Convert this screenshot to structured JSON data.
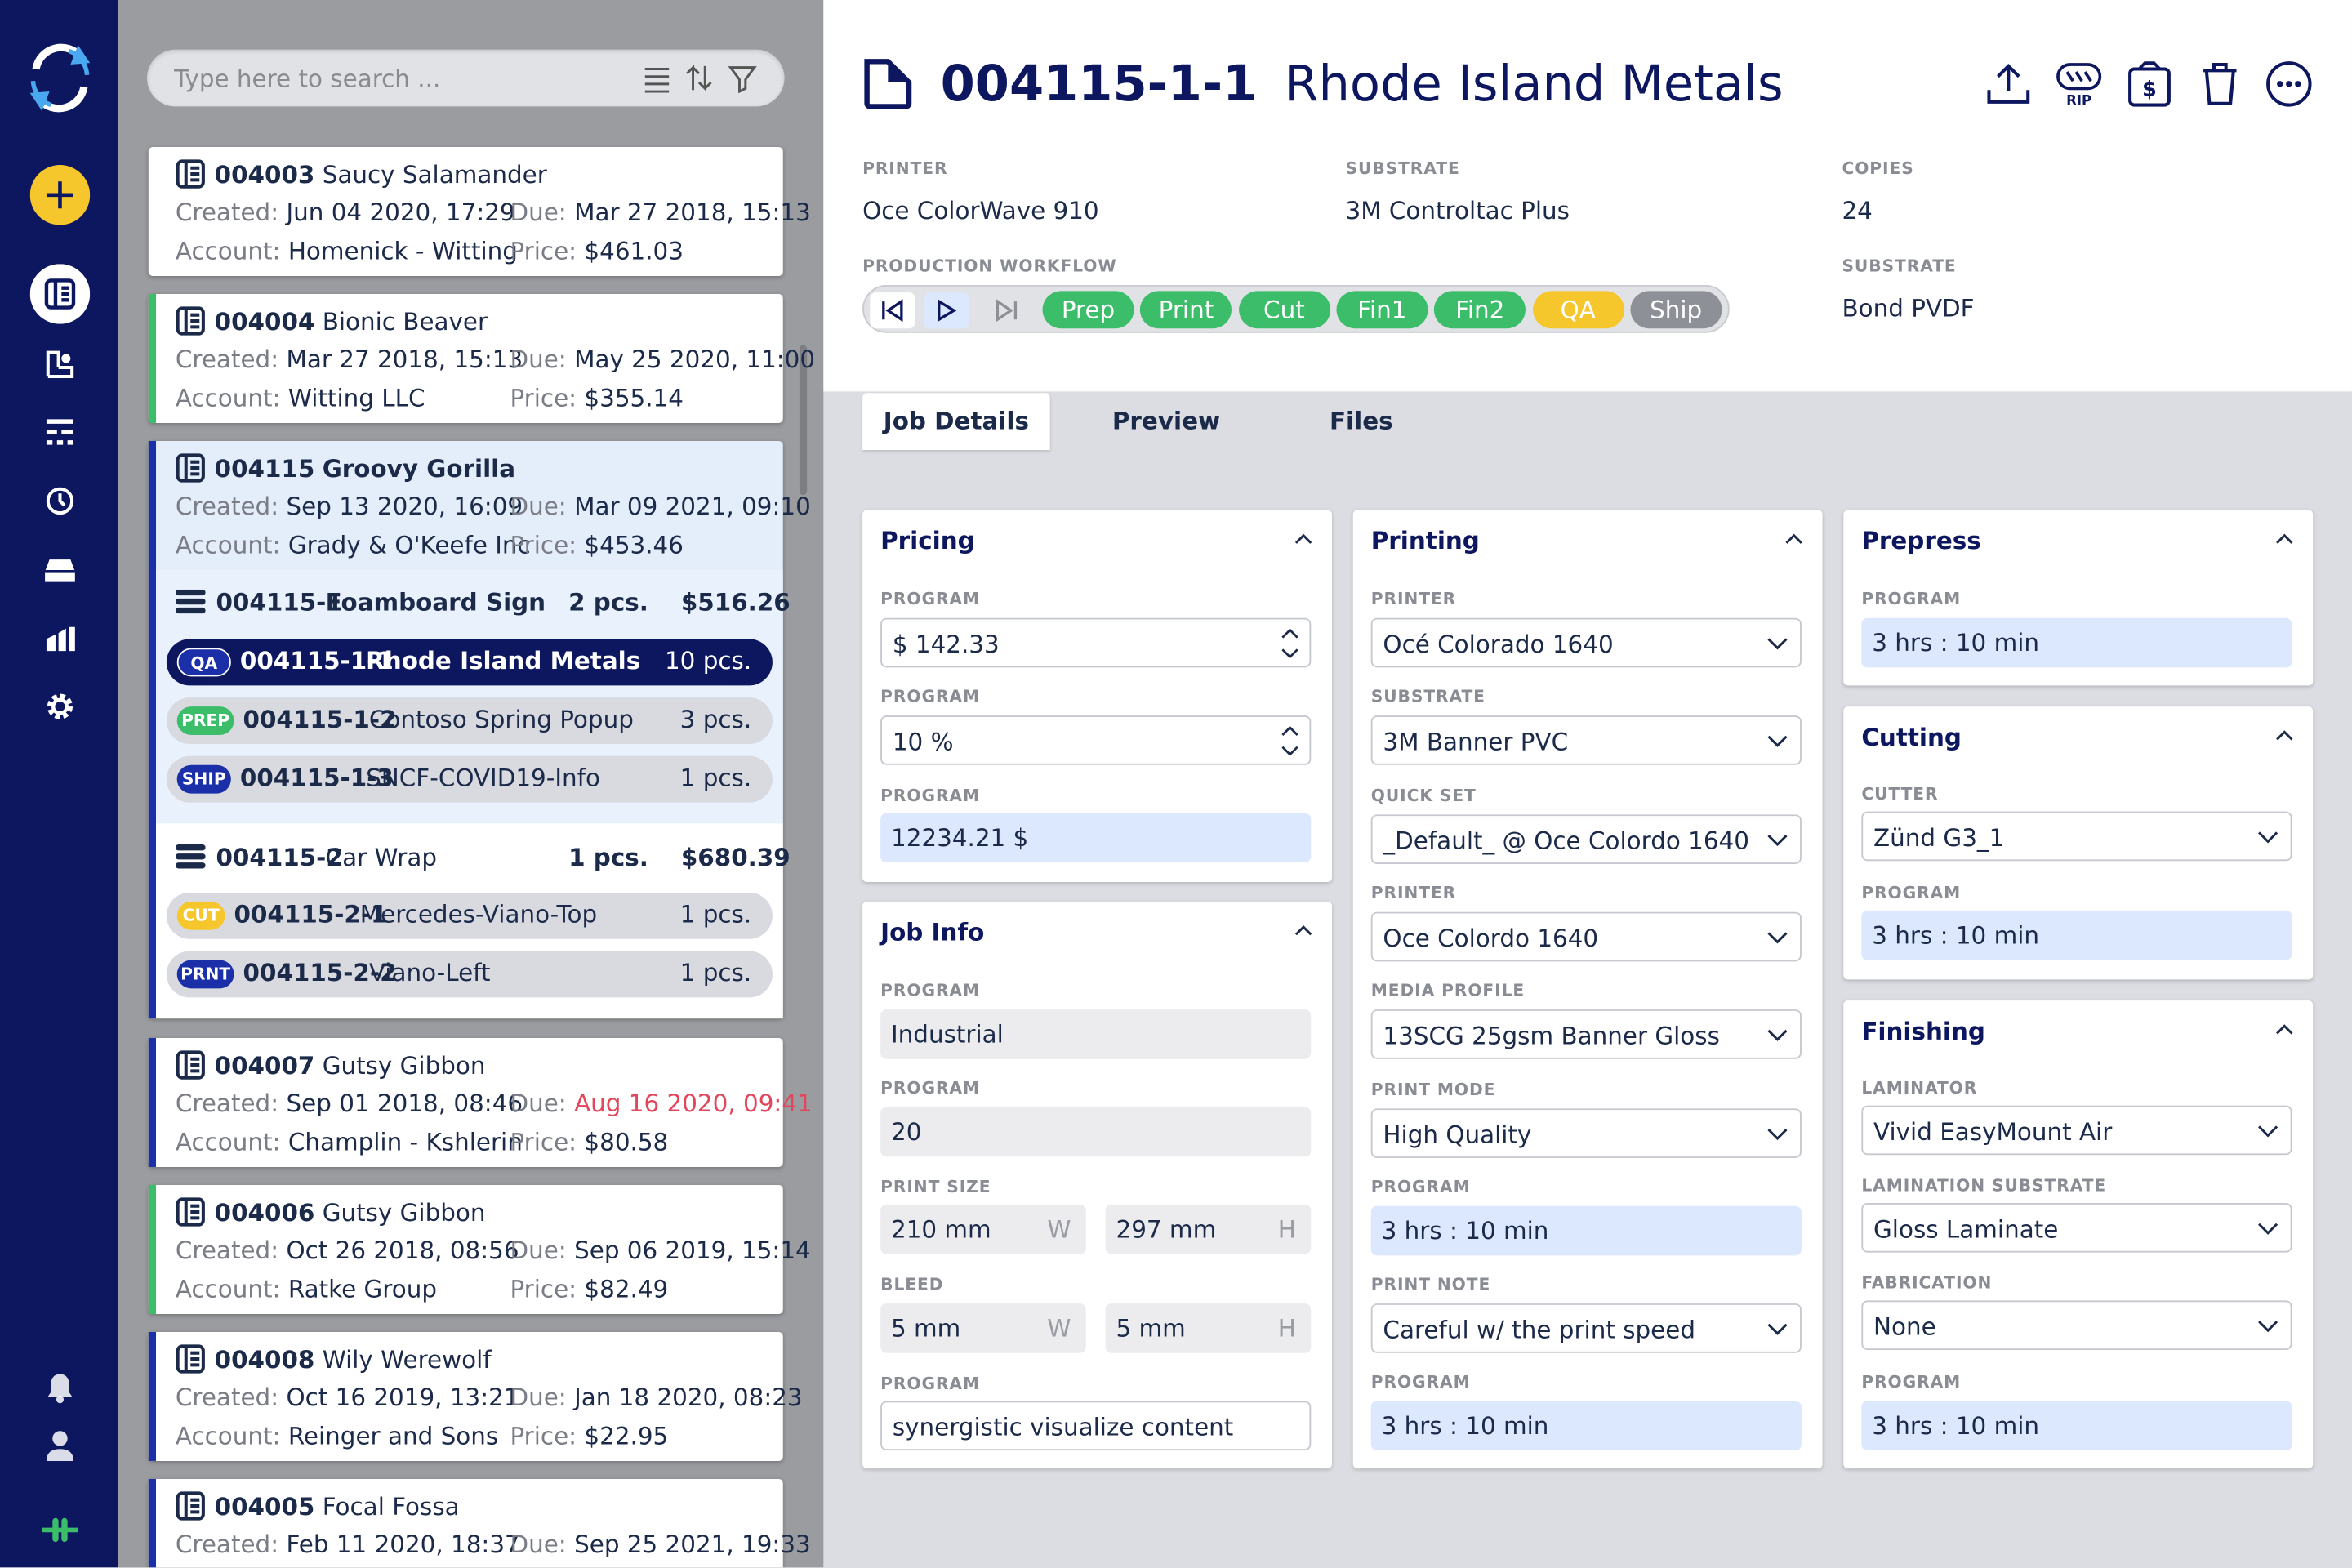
{
  "search": {
    "placeholder": "Type here to search ..."
  },
  "jobs": [
    {
      "id": "004003",
      "name": "Saucy Salamander",
      "created": "Jun 04 2020, 17:29",
      "due": "Mar 27 2018, 15:13",
      "account": "Homenick - Witting",
      "price": "$461.03"
    },
    {
      "id": "004004",
      "name": "Bionic Beaver",
      "created": "Mar 27 2018, 15:13",
      "due": "May 25 2020, 11:00",
      "account": "Witting LLC",
      "price": "$355.14"
    },
    {
      "id": "004115",
      "name": "Groovy Gorilla",
      "created": "Sep 13 2020, 16:09",
      "due": "Mar 09 2021, 09:10",
      "account": "Grady & O'Keefe Inc",
      "price": "$453.46"
    },
    {
      "id": "004007",
      "name": "Gutsy Gibbon",
      "created": "Sep 01 2018, 08:46",
      "due": "Aug 16 2020, 09:41",
      "account": "Champlin - Kshlerin",
      "price": "$80.58"
    },
    {
      "id": "004006",
      "name": "Gutsy Gibbon",
      "created": "Oct 26 2018, 08:56",
      "due": "Sep 06 2019, 15:14",
      "account": "Ratke Group",
      "price": "$82.49"
    },
    {
      "id": "004008",
      "name": "Wily Werewolf",
      "created": "Oct 16 2019, 13:21",
      "due": "Jan 18 2020, 08:23",
      "account": "Reinger and Sons",
      "price": "$22.95"
    },
    {
      "id": "004005",
      "name": "Focal Fossa",
      "created": "Feb 11 2020, 18:37",
      "due": "Sep 25 2021, 19:33",
      "account": "",
      "price": ""
    }
  ],
  "labels": {
    "created": "Created:",
    "due": "Due:",
    "account": "Account:",
    "price": "Price:"
  },
  "subjobs": [
    {
      "id": "004115-1",
      "name": "Foamboard Sign",
      "qty": "2 pcs.",
      "price": "$516.26"
    },
    {
      "id": "004115-2",
      "name": "Car Wrap",
      "qty": "1 pcs.",
      "price": "$680.39"
    }
  ],
  "items": [
    {
      "tag": "QA",
      "id": "004115-1-1",
      "name": "Rhode Island Metals",
      "qty": "10 pcs."
    },
    {
      "tag": "PREP",
      "id": "004115-1-2",
      "name": "Contoso Spring Popup",
      "qty": "3 pcs."
    },
    {
      "tag": "SHIP",
      "id": "004115-1-3",
      "name": "SNCF-COVID19-Info",
      "qty": "1 pcs."
    },
    {
      "tag": "CUT",
      "id": "004115-2-1",
      "name": "Mercedes-Viano-Top",
      "qty": "1 pcs."
    },
    {
      "tag": "PRNT",
      "id": "004115-2-2",
      "name": "Viano-Left",
      "qty": "1 pcs."
    }
  ],
  "detail": {
    "id": "004115-1-1",
    "name": "Rhode Island Metals",
    "printer_label": "PRINTER",
    "printer": "Oce ColorWave 910",
    "substrate_label": "SUBSTRATE",
    "substrate": "3M Controltac Plus",
    "copies_label": "COPIES",
    "copies": "24",
    "workflow_label": "PRODUCTION WORKFLOW",
    "substrate2_label": "SUBSTRATE",
    "substrate2": "Bond PVDF",
    "stages": [
      "Prep",
      "Print",
      "Cut",
      "Fin1",
      "Fin2",
      "QA",
      "Ship"
    ],
    "rip_label": "RIP"
  },
  "colors": {
    "done": "#3cbd6a",
    "current": "#f6c62d",
    "pending": "#8e9097",
    "accent": "#0d1760",
    "overdue": "#e2465b"
  },
  "tabs": [
    "Job Details",
    "Preview",
    "Files"
  ],
  "pricing": {
    "title": "Pricing",
    "l1": "PROGRAM",
    "v1": "$ 142.33",
    "l2": "PROGRAM",
    "v2": "10 %",
    "l3": "PROGRAM",
    "v3": "12234.21 $"
  },
  "jobinfo": {
    "title": "Job Info",
    "l1": "PROGRAM",
    "v1": "Industrial",
    "l2": "PROGRAM",
    "v2": "20",
    "l3": "PRINT SIZE",
    "w": "210 mm",
    "h": "297 mm",
    "l4": "BLEED",
    "bw": "5 mm",
    "bh": "5 mm",
    "l5": "PROGRAM",
    "v5": "synergistic visualize content",
    "wl": "W",
    "hl": "H"
  },
  "printing": {
    "title": "Printing",
    "l1": "PRINTER",
    "v1": "Océ Colorado 1640",
    "l2": "SUBSTRATE",
    "v2": "3M Banner PVC",
    "l3": "QUICK SET",
    "v3": "_Default_ @ Oce Colordo 1640",
    "l4": "PRINTER",
    "v4": "Oce Colordo 1640",
    "l5": "MEDIA PROFILE",
    "v5": "13SCG 25gsm Banner Gloss",
    "l6": "PRINT MODE",
    "v6": "High Quality",
    "l7": "PROGRAM",
    "v7": "3 hrs : 10 min",
    "l8": "PRINT NOTE",
    "v8": "Careful w/ the print speed",
    "l9": "PROGRAM",
    "v9": "3 hrs : 10 min"
  },
  "prepress": {
    "title": "Prepress",
    "l1": "PROGRAM",
    "v1": "3 hrs : 10 min"
  },
  "cutting": {
    "title": "Cutting",
    "l1": "CUTTER",
    "v1": "Zünd G3_1",
    "l2": "PROGRAM",
    "v2": "3 hrs : 10 min"
  },
  "finishing": {
    "title": "Finishing",
    "l1": "LAMINATOR",
    "v1": "Vivid EasyMount Air",
    "l2": "LAMINATION SUBSTRATE",
    "v2": "Gloss Laminate",
    "l3": "FABRICATION",
    "v3": "None",
    "l4": "PROGRAM",
    "v4": "3 hrs : 10 min"
  }
}
